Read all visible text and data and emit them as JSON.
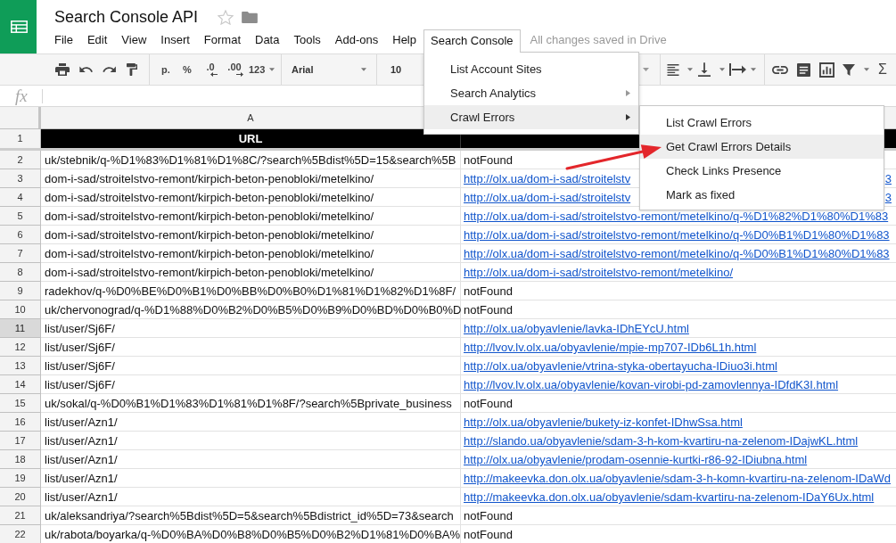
{
  "document": {
    "title": "Search Console API",
    "starred": false
  },
  "menu_bar": [
    {
      "label": "File",
      "open": false
    },
    {
      "label": "Edit",
      "open": false
    },
    {
      "label": "View",
      "open": false
    },
    {
      "label": "Insert",
      "open": false
    },
    {
      "label": "Format",
      "open": false
    },
    {
      "label": "Data",
      "open": false
    },
    {
      "label": "Tools",
      "open": false
    },
    {
      "label": "Add-ons",
      "open": false
    },
    {
      "label": "Help",
      "open": false
    },
    {
      "label": "Search Console",
      "open": true
    }
  ],
  "save_status": "All changes saved in Drive",
  "toolbar": {
    "currency_format": "p.",
    "percent_format": "%",
    "decrease_decimals": ".0",
    "increase_decimals": ".00",
    "more_formats": "123",
    "font": "Arial",
    "font_size": "10",
    "functions": "Σ"
  },
  "formula_bar": {
    "label": "fx"
  },
  "sheet": {
    "column_headers": [
      "A"
    ],
    "header_row": {
      "number": "1",
      "cells": [
        "URL"
      ]
    },
    "rows": [
      {
        "number": "2",
        "selected": false,
        "cells": [
          {
            "kind": "text",
            "text": "uk/stebnik/q-%D1%83%D1%81%D1%8C/?search%5Bdist%5D=15&search%5B"
          },
          {
            "kind": "text",
            "text": "notFound"
          }
        ]
      },
      {
        "number": "3",
        "selected": false,
        "cells": [
          {
            "kind": "text",
            "text": "dom-i-sad/stroitelstvo-remont/kirpich-beton-penobloki/metelkino/"
          },
          {
            "kind": "link",
            "text": "http://olx.ua/dom-i-sad/stroitelstv",
            "tail": "3"
          }
        ]
      },
      {
        "number": "4",
        "selected": false,
        "cells": [
          {
            "kind": "text",
            "text": "dom-i-sad/stroitelstvo-remont/kirpich-beton-penobloki/metelkino/"
          },
          {
            "kind": "link",
            "text": "http://olx.ua/dom-i-sad/stroitelstv",
            "tail": "3"
          }
        ]
      },
      {
        "number": "5",
        "selected": false,
        "cells": [
          {
            "kind": "text",
            "text": "dom-i-sad/stroitelstvo-remont/kirpich-beton-penobloki/metelkino/"
          },
          {
            "kind": "link",
            "text": "http://olx.ua/dom-i-sad/stroitelstvo-remont/metelkino/q-%D1%82%D1%80%D1%83"
          }
        ]
      },
      {
        "number": "6",
        "selected": false,
        "cells": [
          {
            "kind": "text",
            "text": "dom-i-sad/stroitelstvo-remont/kirpich-beton-penobloki/metelkino/"
          },
          {
            "kind": "link",
            "text": "http://olx.ua/dom-i-sad/stroitelstvo-remont/metelkino/q-%D0%B1%D1%80%D1%83"
          }
        ]
      },
      {
        "number": "7",
        "selected": false,
        "cells": [
          {
            "kind": "text",
            "text": "dom-i-sad/stroitelstvo-remont/kirpich-beton-penobloki/metelkino/"
          },
          {
            "kind": "link",
            "text": "http://olx.ua/dom-i-sad/stroitelstvo-remont/metelkino/q-%D0%B1%D1%80%D1%83"
          }
        ]
      },
      {
        "number": "8",
        "selected": false,
        "cells": [
          {
            "kind": "text",
            "text": "dom-i-sad/stroitelstvo-remont/kirpich-beton-penobloki/metelkino/"
          },
          {
            "kind": "link",
            "text": "http://olx.ua/dom-i-sad/stroitelstvo-remont/metelkino/"
          }
        ]
      },
      {
        "number": "9",
        "selected": false,
        "cells": [
          {
            "kind": "text",
            "text": "radekhov/q-%D0%BE%D0%B1%D0%BB%D0%B0%D1%81%D1%82%D1%8F/"
          },
          {
            "kind": "text",
            "text": "notFound"
          }
        ]
      },
      {
        "number": "10",
        "selected": false,
        "cells": [
          {
            "kind": "text",
            "text": "uk/chervonograd/q-%D1%88%D0%B2%D0%B5%D0%B9%D0%BD%D0%B0%D"
          },
          {
            "kind": "text",
            "text": "notFound"
          }
        ]
      },
      {
        "number": "11",
        "selected": true,
        "cells": [
          {
            "kind": "text",
            "text": "list/user/Sj6F/"
          },
          {
            "kind": "link",
            "text": "http://olx.ua/obyavlenie/lavka-IDhEYcU.html"
          }
        ]
      },
      {
        "number": "12",
        "selected": false,
        "cells": [
          {
            "kind": "text",
            "text": "list/user/Sj6F/"
          },
          {
            "kind": "link",
            "text": "http://lvov.lv.olx.ua/obyavlenie/mpie-mp707-IDb6L1h.html"
          }
        ]
      },
      {
        "number": "13",
        "selected": false,
        "cells": [
          {
            "kind": "text",
            "text": "list/user/Sj6F/"
          },
          {
            "kind": "link",
            "text": "http://olx.ua/obyavlenie/vtrina-styka-obertayucha-IDiuo3i.html"
          }
        ]
      },
      {
        "number": "14",
        "selected": false,
        "cells": [
          {
            "kind": "text",
            "text": "list/user/Sj6F/"
          },
          {
            "kind": "link",
            "text": "http://lvov.lv.olx.ua/obyavlenie/kovan-virobi-pd-zamovlennya-IDfdK3I.html"
          }
        ]
      },
      {
        "number": "15",
        "selected": false,
        "cells": [
          {
            "kind": "text",
            "text": "uk/sokal/q-%D0%B1%D1%83%D1%81%D1%8F/?search%5Bprivate_business"
          },
          {
            "kind": "text",
            "text": "notFound"
          }
        ]
      },
      {
        "number": "16",
        "selected": false,
        "cells": [
          {
            "kind": "text",
            "text": "list/user/Azn1/"
          },
          {
            "kind": "link",
            "text": "http://olx.ua/obyavlenie/bukety-iz-konfet-IDhwSsa.html"
          }
        ]
      },
      {
        "number": "17",
        "selected": false,
        "cells": [
          {
            "kind": "text",
            "text": "list/user/Azn1/"
          },
          {
            "kind": "link",
            "text": "http://slando.ua/obyavlenie/sdam-3-h-kom-kvartiru-na-zelenom-IDajwKL.html"
          }
        ]
      },
      {
        "number": "18",
        "selected": false,
        "cells": [
          {
            "kind": "text",
            "text": "list/user/Azn1/"
          },
          {
            "kind": "link",
            "text": "http://olx.ua/obyavlenie/prodam-osennie-kurtki-r86-92-IDiubna.html"
          }
        ]
      },
      {
        "number": "19",
        "selected": false,
        "cells": [
          {
            "kind": "text",
            "text": "list/user/Azn1/"
          },
          {
            "kind": "link",
            "text": "http://makeevka.don.olx.ua/obyavlenie/sdam-3-h-komn-kvartiru-na-zelenom-IDaWd"
          }
        ]
      },
      {
        "number": "20",
        "selected": false,
        "cells": [
          {
            "kind": "text",
            "text": "list/user/Azn1/"
          },
          {
            "kind": "link",
            "text": "http://makeevka.don.olx.ua/obyavlenie/sdam-kvartiru-na-zelenom-IDaY6Ux.html"
          }
        ]
      },
      {
        "number": "21",
        "selected": false,
        "cells": [
          {
            "kind": "text",
            "text": "uk/aleksandriya/?search%5Bdist%5D=5&search%5Bdistrict_id%5D=73&search"
          },
          {
            "kind": "text",
            "text": "notFound"
          }
        ]
      },
      {
        "number": "22",
        "selected": false,
        "cells": [
          {
            "kind": "text",
            "text": "uk/rabota/boyarka/q-%D0%BA%D0%B8%D0%B5%D0%B2%D1%81%D0%BA%"
          },
          {
            "kind": "text",
            "text": "notFound"
          }
        ]
      }
    ]
  },
  "open_menu": {
    "items": [
      {
        "label": "List Account Sites",
        "submenu": false,
        "highlighted": false
      },
      {
        "label": "Search Analytics",
        "submenu": true,
        "highlighted": false
      },
      {
        "label": "Crawl Errors",
        "submenu": true,
        "highlighted": true
      }
    ]
  },
  "submenu": {
    "items": [
      {
        "label": "List Crawl Errors",
        "highlighted": false
      },
      {
        "label": "Get Crawl Errors Details",
        "highlighted": true
      },
      {
        "label": "Check Links Presence",
        "highlighted": false
      },
      {
        "label": "Mark as fixed",
        "highlighted": false
      }
    ]
  }
}
